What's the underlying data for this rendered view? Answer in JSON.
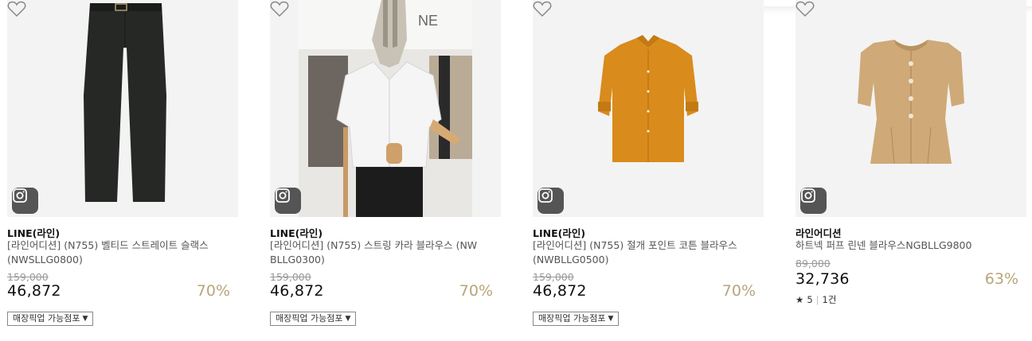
{
  "products": [
    {
      "brand": "LINE(라인)",
      "name": "[라인어디션] (N755) 벨티드 스트레이트 슬랙스 (NWSLLG0800)",
      "original_price": "159,000",
      "price": "46,872",
      "discount": "70%",
      "pickup_label": "매장픽업 가능점포",
      "image": "black-slacks"
    },
    {
      "brand": "LINE(라인)",
      "name": "[라인어디션] (N755) 스트링 카라 블라우스 (NWBLLG0300)",
      "original_price": "159,000",
      "price": "46,872",
      "discount": "70%",
      "pickup_label": "매장픽업 가능점포",
      "image": "white-blouse-mannequin"
    },
    {
      "brand": "LINE(라인)",
      "name": "[라인어디션] (N755) 절개 포인트 코튼 블라우스 (NWBLLG0500)",
      "original_price": "159,000",
      "price": "46,872",
      "discount": "70%",
      "pickup_label": "매장픽업 가능점포",
      "image": "orange-blouse"
    },
    {
      "brand": "라인어디션",
      "name": "하트넥 퍼프 린넨 블라우스NGBLLG9800",
      "original_price": "89,000",
      "price": "32,736",
      "discount": "63%",
      "rating": "5",
      "review_count": "1건",
      "image": "beige-blouse"
    }
  ],
  "colors": {
    "discount": "#b8a57a",
    "thumb_bg": "#f3f3f3",
    "insta_badge": "#555555"
  },
  "icons": {
    "instagram": "instagram-icon",
    "wishlist": "heart-outline-icon",
    "star": "star-icon",
    "dropdown": "caret-down-icon"
  }
}
